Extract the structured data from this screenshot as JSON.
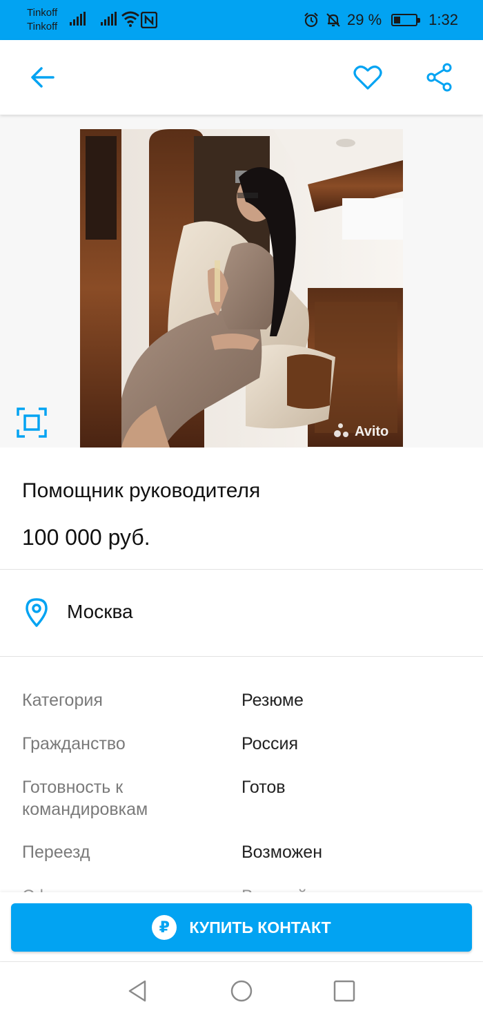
{
  "status_bar": {
    "carrier1": "Tinkoff",
    "carrier2": "Tinkoff",
    "battery_percent": "29 %",
    "battery_level": 0.29,
    "time": "1:32"
  },
  "app_bar": {
    "back_icon": "arrow-left-icon",
    "favorite_icon": "heart-outline-icon",
    "share_icon": "share-icon"
  },
  "listing": {
    "title": "Помощник руководителя",
    "price": "100 000 руб.",
    "location": "Москва",
    "watermark": "Avito"
  },
  "params": [
    {
      "label": "Категория",
      "value": "Резюме"
    },
    {
      "label": "Гражданство",
      "value": "Россия"
    },
    {
      "label": "Готовность к командировкам",
      "value": "Готов"
    },
    {
      "label": "Переезд",
      "value": "Возможен"
    },
    {
      "label": "Сфера деятельности",
      "value": "Высший менеджмент"
    }
  ],
  "buy_button": {
    "label": "КУПИТЬ КОНТАКТ",
    "icon": "₽"
  },
  "colors": {
    "accent": "#02a3f2",
    "text_primary": "#111111",
    "text_secondary": "#7a7a7a"
  }
}
